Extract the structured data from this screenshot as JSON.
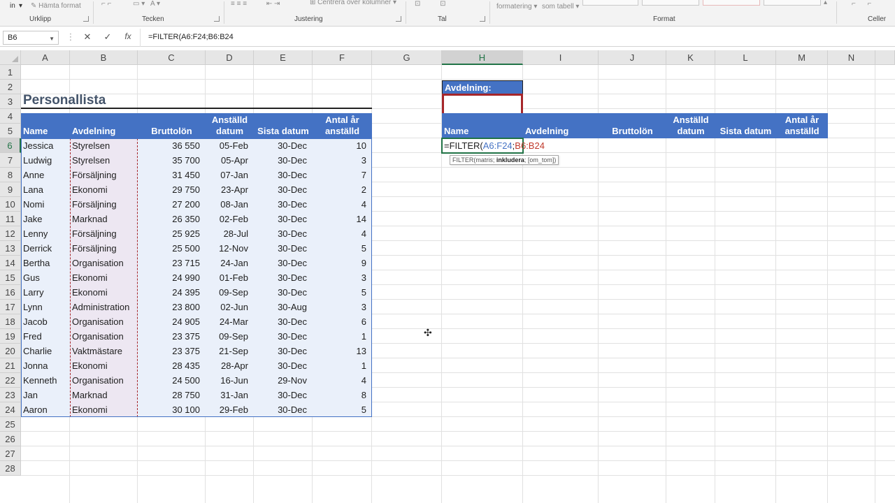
{
  "ribbon": {
    "left_stub": "in",
    "paste_format": "Hämta format",
    "center_across": "Centrera över kolumner",
    "conditional_format": "formatering",
    "as_table": "som tabell",
    "groups": [
      "Urklipp",
      "Tecken",
      "Justering",
      "Tal",
      "Format",
      "Celler"
    ]
  },
  "formula_bar": {
    "name_box": "B6",
    "cancel_icon": "close-icon",
    "enter_icon": "check-icon",
    "fx_label": "fx",
    "formula": "=FILTER(A6:F24;B6:B24"
  },
  "columns": [
    "A",
    "B",
    "C",
    "D",
    "E",
    "F",
    "G",
    "H",
    "I",
    "J",
    "K",
    "L",
    "M",
    "N"
  ],
  "rows": [
    "1",
    "2",
    "3",
    "4",
    "5",
    "6",
    "7",
    "8",
    "9",
    "10",
    "11",
    "12",
    "13",
    "14",
    "15",
    "16",
    "17",
    "18",
    "19",
    "20",
    "21",
    "22",
    "23",
    "24",
    "25",
    "26",
    "27",
    "28"
  ],
  "selected_column": "H",
  "selected_row": "6",
  "sheet": {
    "title": "Personallista",
    "headers": {
      "name": "Name",
      "dept": "Avdelning",
      "salary": "Bruttolön",
      "hired_1": "Anställd",
      "hired_2": "datum",
      "last": "Sista datum",
      "years_1": "Antal år",
      "years_2": "anställd"
    },
    "rows": [
      [
        "Jessica",
        "Styrelsen",
        "36 550",
        "05-Feb",
        "30-Dec",
        "10"
      ],
      [
        "Ludwig",
        "Styrelsen",
        "35 700",
        "05-Apr",
        "30-Dec",
        "3"
      ],
      [
        "Anne",
        "Försäljning",
        "31 450",
        "07-Jan",
        "30-Dec",
        "7"
      ],
      [
        "Lana",
        "Ekonomi",
        "29 750",
        "23-Apr",
        "30-Dec",
        "2"
      ],
      [
        "Nomi",
        "Försäljning",
        "27 200",
        "08-Jan",
        "30-Dec",
        "4"
      ],
      [
        "Jake",
        "Marknad",
        "26 350",
        "02-Feb",
        "30-Dec",
        "14"
      ],
      [
        "Lenny",
        "Försäljning",
        "25 925",
        "28-Jul",
        "30-Dec",
        "4"
      ],
      [
        "Derrick",
        "Försäljning",
        "25 500",
        "12-Nov",
        "30-Dec",
        "5"
      ],
      [
        "Bertha",
        "Organisation",
        "23 715",
        "24-Jan",
        "30-Dec",
        "9"
      ],
      [
        "Gus",
        "Ekonomi",
        "24 990",
        "01-Feb",
        "30-Dec",
        "3"
      ],
      [
        "Larry",
        "Ekonomi",
        "24 395",
        "09-Sep",
        "30-Dec",
        "5"
      ],
      [
        "Lynn",
        "Administration",
        "23 800",
        "02-Jun",
        "30-Aug",
        "3"
      ],
      [
        "Jacob",
        "Organisation",
        "24 905",
        "24-Mar",
        "30-Dec",
        "6"
      ],
      [
        "Fred",
        "Organisation",
        "23 375",
        "09-Sep",
        "30-Dec",
        "1"
      ],
      [
        "Charlie",
        "Vaktmästare",
        "23 375",
        "21-Sep",
        "30-Dec",
        "13"
      ],
      [
        "Jonna",
        "Ekonomi",
        "28 435",
        "28-Apr",
        "30-Dec",
        "1"
      ],
      [
        "Kenneth",
        "Organisation",
        "24 500",
        "16-Jun",
        "29-Nov",
        "4"
      ],
      [
        "Jan",
        "Marknad",
        "28 750",
        "31-Jan",
        "30-Dec",
        "8"
      ],
      [
        "Aaron",
        "Ekonomi",
        "30 100",
        "29-Feb",
        "30-Dec",
        "5"
      ]
    ]
  },
  "criteria": {
    "label": "Avdelning:",
    "value": ""
  },
  "formula_cell": {
    "prefix": "=FILTER(",
    "ref1": "A6:F24",
    "sep": ";",
    "ref2": "B6:B24",
    "ref1_color": "#4472c4",
    "ref2_color": "#c0392b"
  },
  "tooltip": {
    "fn": "FILTER(",
    "arg1": "matris; ",
    "arg2": "inkludera",
    "arg3": "; [om_tom])"
  },
  "colors": {
    "header_blue": "#4472c4",
    "criteria_border": "#a6262a",
    "excel_green": "#217346"
  }
}
